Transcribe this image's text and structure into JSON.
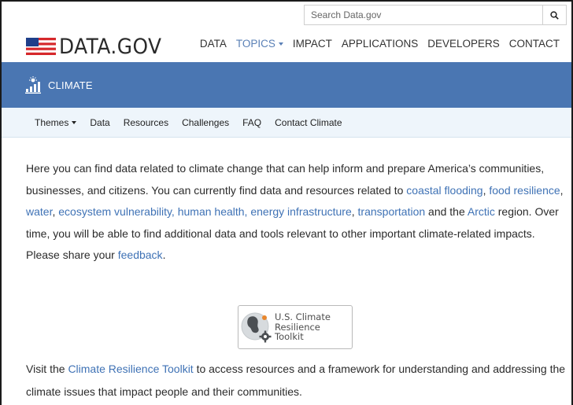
{
  "search": {
    "placeholder": "Search Data.gov"
  },
  "logo": {
    "text": "DATA.GOV"
  },
  "mainnav": {
    "data": "DATA",
    "topics": "TOPICS",
    "impact": "IMPACT",
    "applications": "APPLICATIONS",
    "developers": "DEVELOPERS",
    "contact": "CONTACT"
  },
  "banner": {
    "title": "CLIMATE"
  },
  "subnav": {
    "themes": "Themes",
    "data": "Data",
    "resources": "Resources",
    "challenges": "Challenges",
    "faq": "FAQ",
    "contact": "Contact Climate"
  },
  "intro": {
    "t1": "Here you can find data related to climate change that can help inform and prepare America’s communities, businesses, and citizens. You can currently find data and resources related to ",
    "coastal_flooding": "coastal flooding",
    "comma1": ", ",
    "food_resilience": "food resilience",
    "comma2": ", ",
    "water": "water",
    "comma3": ", ",
    "ecosystem": "ecosystem vulnerability,",
    "sp1": " ",
    "human_health": "human health,",
    "sp2": " ",
    "energy": "energy infrastructure",
    "comma4": ", ",
    "transportation": "transportation",
    "t2": " and the ",
    "arctic": "Arctic",
    "t3": " region. Over time, you will be able to find additional data and tools relevant to other important climate-related impacts. Please share your ",
    "feedback": "feedback",
    "t4": "."
  },
  "toolkit": {
    "line1": "U.S. Climate",
    "line2": "Resilience",
    "line3": "Toolkit"
  },
  "visit": {
    "t1": "Visit the ",
    "link": "Climate Resilience Toolkit",
    "t2": " to access resources and a framework for understanding and addressing the climate issues that impact people and their communities."
  }
}
